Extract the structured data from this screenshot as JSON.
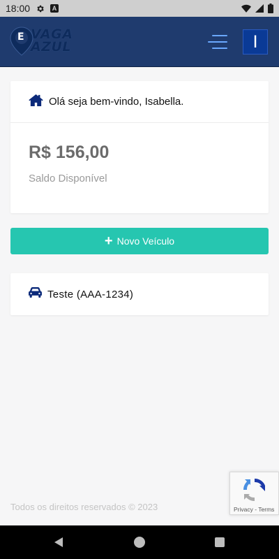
{
  "status_bar": {
    "time": "18:00",
    "settings_icon": "gear-icon",
    "notification_icon": "a-box-icon",
    "wifi_icon": "wifi-icon",
    "signal_icon": "signal-icon",
    "battery_icon": "battery-icon"
  },
  "header": {
    "logo_letter": "E",
    "logo_line1": "VAGA",
    "logo_line2": "AZUL",
    "menu_icon": "hamburger-menu-icon",
    "avatar_initial": "I",
    "colors": {
      "background": "#1f3b6e",
      "avatar": "#0a3a96",
      "menu": "#6aa8ff"
    }
  },
  "welcome_card": {
    "icon": "home-icon",
    "greeting": "Olá seja bem-vindo, Isabella.",
    "balance": "R$ 156,00",
    "balance_label": "Saldo Disponível"
  },
  "actions": {
    "new_vehicle_label": "Novo Veículo",
    "new_vehicle_icon": "plus-icon",
    "accent_color": "#26c6b0"
  },
  "vehicles": [
    {
      "icon": "car-icon",
      "label": "Teste (AAA-1234)"
    }
  ],
  "footer": {
    "copyright": "Todos os direitos reservados © 2023"
  },
  "recaptcha": {
    "links": "Privacy - Terms"
  }
}
